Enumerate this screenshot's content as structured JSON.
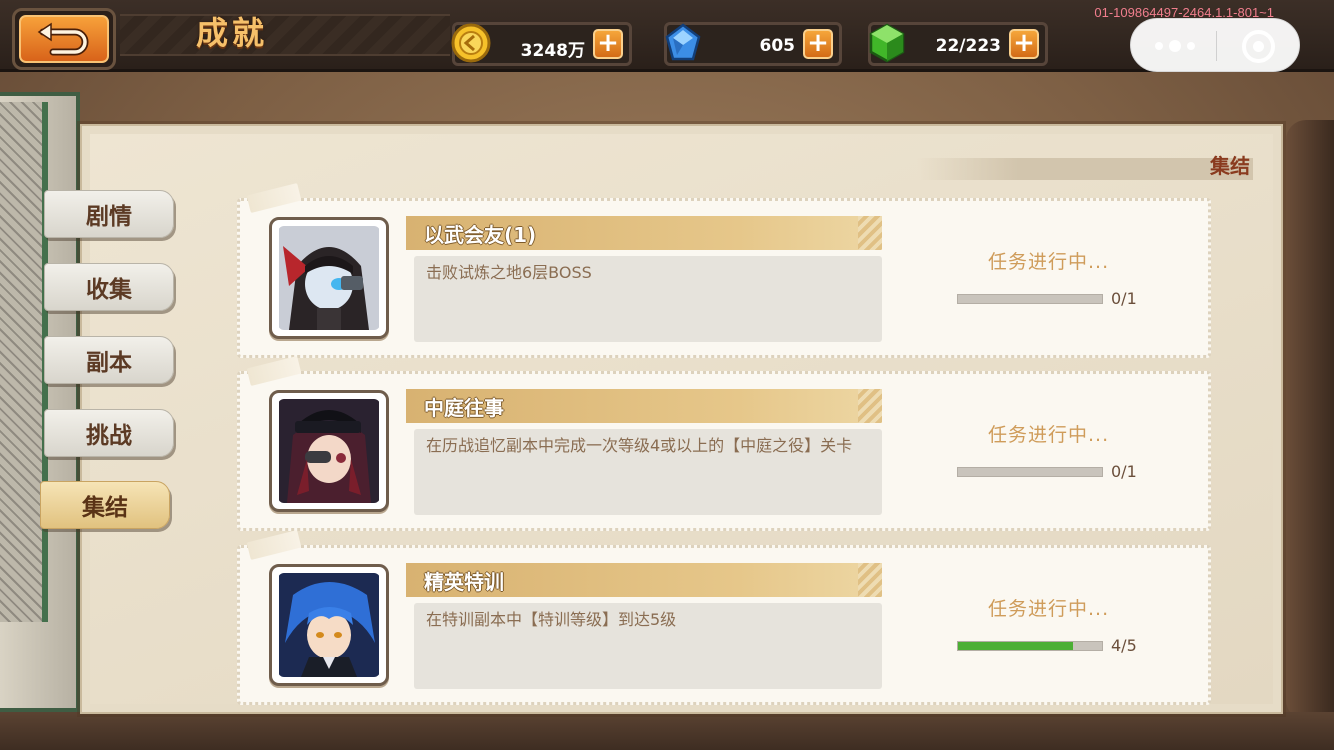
{
  "header": {
    "title": "成就",
    "build_id": "01-109864497-2464.1.1-801~1"
  },
  "resources": [
    {
      "icon": "gold-coin-icon",
      "value": "3248万"
    },
    {
      "icon": "blue-gem-icon",
      "value": "605"
    },
    {
      "icon": "green-stamina-icon",
      "value": "22/223"
    }
  ],
  "colors": {
    "accent_orange": "#e07a23",
    "progress_green": "#4caf35",
    "title_gold": "#f6c06a"
  },
  "tabs": [
    {
      "label": "剧情",
      "active": false
    },
    {
      "label": "收集",
      "active": false
    },
    {
      "label": "副本",
      "active": false
    },
    {
      "label": "挑战",
      "active": false
    },
    {
      "label": "集结",
      "active": true
    }
  ],
  "section_title": "集结",
  "achievements": [
    {
      "title": "以武会友(1)",
      "description": "击败试炼之地6层BOSS",
      "status": "任务进行中...",
      "progress": "0/1",
      "progress_fraction": 0
    },
    {
      "title": "中庭往事",
      "description": "在历战追忆副本中完成一次等级4或以上的【中庭之役】关卡",
      "status": "任务进行中...",
      "progress": "0/1",
      "progress_fraction": 0
    },
    {
      "title": "精英特训",
      "description": "在特训副本中【特训等级】到达5级",
      "status": "任务进行中...",
      "progress": "4/5",
      "progress_fraction": 0.8
    }
  ]
}
